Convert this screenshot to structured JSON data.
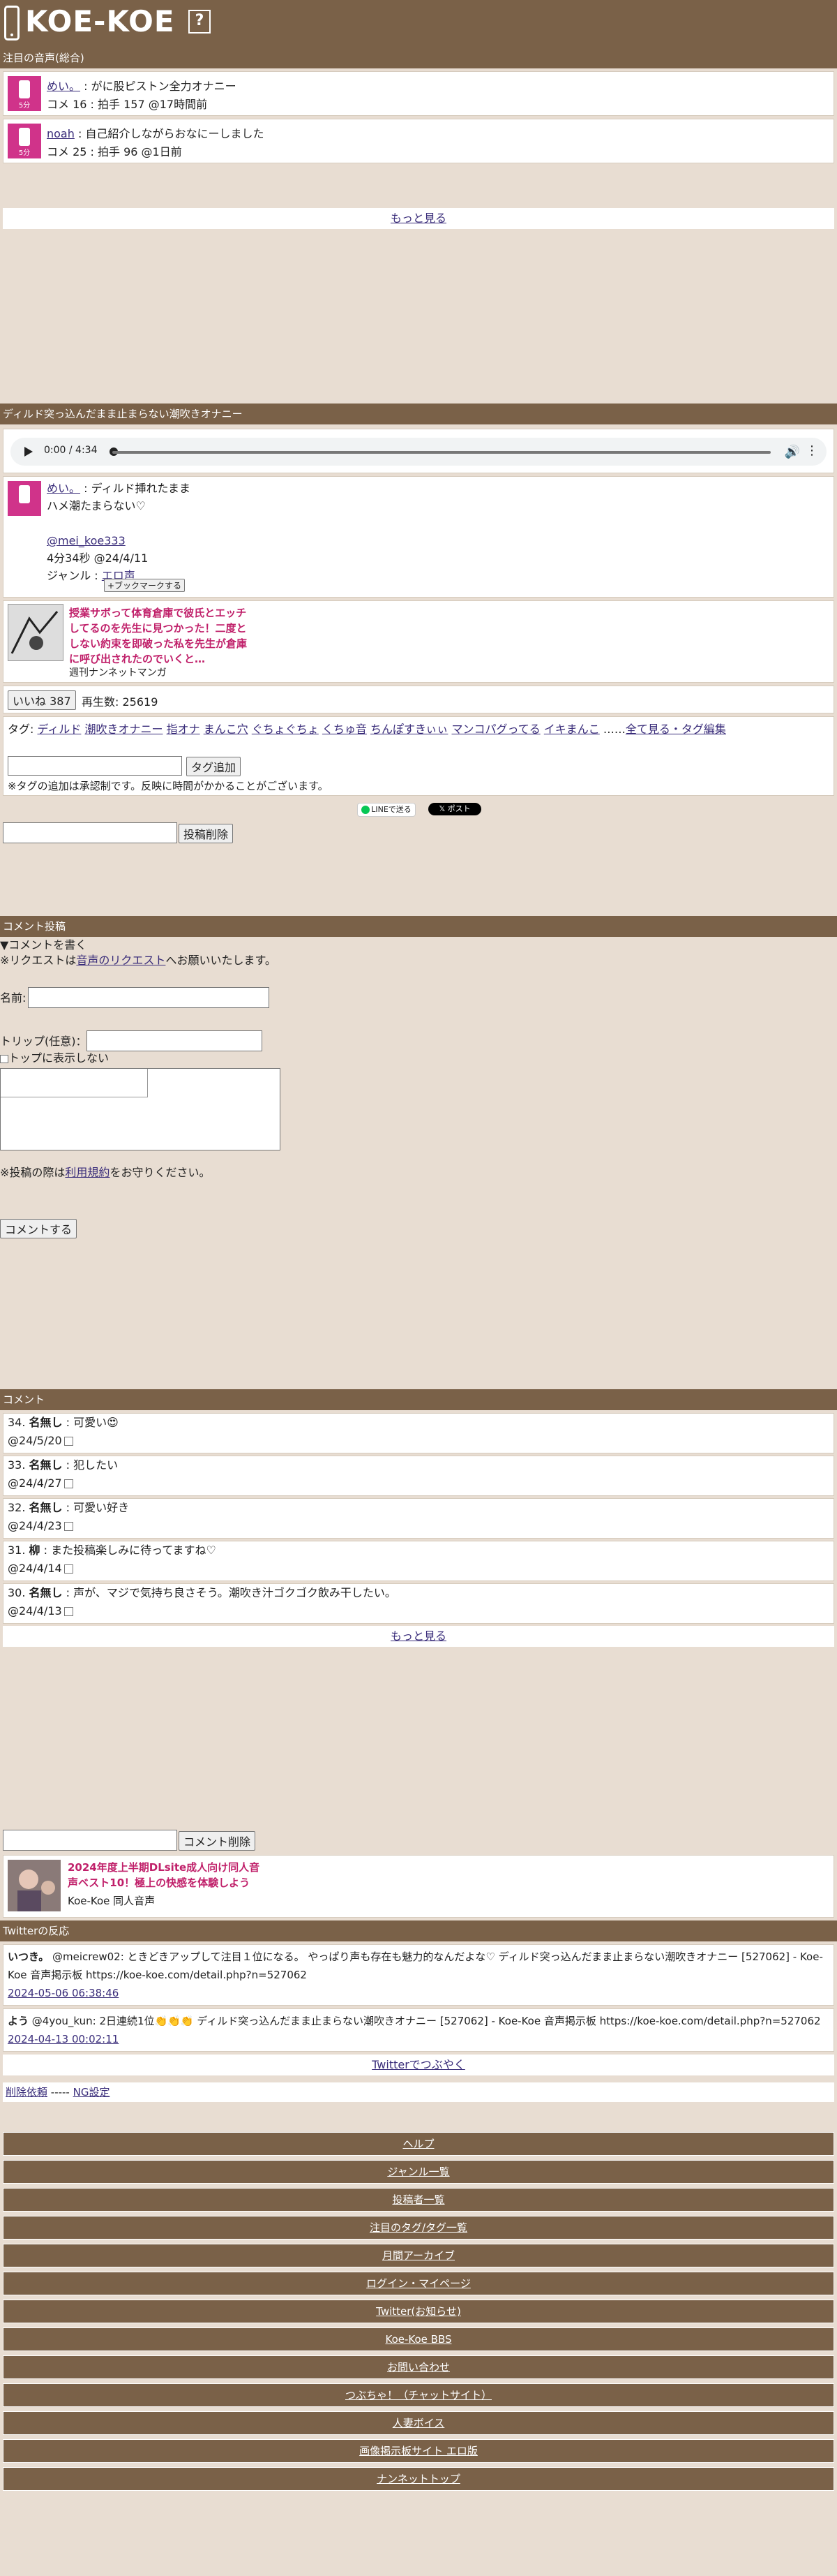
{
  "header": {
    "logo": "KOE-KOE",
    "help": "?"
  },
  "featured": {
    "title": "注目の音声(総合)",
    "items": [
      {
        "user": "めい。",
        "post_title": "がに股ピストン全力オナニー",
        "meta": "コメ 16 : 拍手 157 @17時間前",
        "thumb_label": "5分"
      },
      {
        "user": "noah",
        "post_title": "自己紹介しながらおなにーしました",
        "meta": "コメ 25 : 拍手 96 @1日前",
        "thumb_label": "5分"
      }
    ],
    "more": "もっと見る"
  },
  "post": {
    "title": "ディルド突っ込んだまま止まらない潮吹きオナニー",
    "audio_time": "0:00 / 4:34",
    "user": "めい。",
    "desc1": "ディルド挿れたまま",
    "desc2": "ハメ潮たまらない♡",
    "handle": "@mei_koe333",
    "length": "4分34秒 @24/4/11",
    "genre_label": "ジャンル :",
    "genre": "エロ声",
    "bookmark": "+ブックマークする",
    "ad_title": "授業サボって体育倉庫で彼氏とエッチしてるのを先生に見つかった！二度としない約束を即破った私を先生が倉庫に呼び出されたのでいくと…",
    "ad_source": "週刊ナンネットマンガ",
    "like_btn": "いいね 387",
    "plays": "再生数: 25619",
    "tags_label": "タグ:",
    "tags": [
      "ディルド",
      "潮吹きオナニー",
      "指オナ",
      "まんこ穴",
      "ぐちょぐちょ",
      "くちゅ音",
      "ちんぽすきぃぃ",
      "マンコパグってる",
      "イキまんこ"
    ],
    "tags_sep": "……",
    "tags_all": "全て見る・タグ編集",
    "tag_add": "タグ追加",
    "tag_note": "※タグの追加は承認制です。反映に時間がかかることがございます。",
    "line_btn": "LINEで送る",
    "x_btn": "ポスト",
    "delete_btn": "投稿削除"
  },
  "comment_form": {
    "title": "コメント投稿",
    "toggle": "▼コメントを書く",
    "request_pre": "※リクエストは",
    "request_link": "音声のリクエスト",
    "request_post": "へお願いいたします。",
    "name_label": "名前:",
    "trip_label": "トリップ(任意)：",
    "top_label": "トップに表示しない",
    "rules_pre": "※投稿の際は",
    "rules_link": "利用規約",
    "rules_post": "をお守りください。",
    "submit": "コメントする"
  },
  "comments": {
    "title": "コメント",
    "items": [
      {
        "num": "34.",
        "name": "名無し",
        "text": ": 可愛い😍",
        "date": "@24/5/20"
      },
      {
        "num": "33.",
        "name": "名無し",
        "text": ": 犯したい",
        "date": "@24/4/27"
      },
      {
        "num": "32.",
        "name": "名無し",
        "text": ": 可愛い好き",
        "date": "@24/4/23"
      },
      {
        "num": "31.",
        "name": "柳",
        "text": ": また投稿楽しみに待ってますね♡",
        "date": "@24/4/14"
      },
      {
        "num": "30.",
        "name": "名無し",
        "text": ": 声が、マジで気持ち良さそう。潮吹き汁ゴクゴク飲み干したい。",
        "date": "@24/4/13"
      }
    ],
    "more": "もっと見る",
    "delete_btn": "コメント削除"
  },
  "promo": {
    "title1": "2024年度上半期DLsite成人向け同人音",
    "title2": "声ベスト10！極上の快感を体験しよう",
    "source": "Koe-Koe 同人音声"
  },
  "twitter": {
    "title": "Twitterの反応",
    "items": [
      {
        "user": "いつき。",
        "text": "@meicrew02: ときどきアップして注目１位になる。 やっぱり声も存在も魅力的なんだよな♡ ディルド突っ込んだまま止まらない潮吹きオナニー [527062] - Koe-Koe 音声掲示板 https://koe-koe.com/detail.php?n=527062",
        "date": "2024-05-06 06:38:46"
      },
      {
        "user": "よう",
        "text": "@4you_kun: 2日連続1位👏👏👏 ディルド突っ込んだまま止まらない潮吹きオナニー [527062] - Koe-Koe 音声掲示板 https://koe-koe.com/detail.php?n=527062",
        "date": "2024-04-13 00:02:11"
      }
    ],
    "tweet_link": "Twitterでつぶやく"
  },
  "misc": {
    "delete_req": "削除依頼",
    "sep": " ----- ",
    "ng": "NG設定"
  },
  "footer": [
    "ヘルプ",
    "ジャンル一覧",
    "投稿者一覧",
    "注目のタグ/タグ一覧",
    "月間アーカイブ",
    "ログイン・マイページ",
    "Twitter(お知らせ)",
    "Koe-Koe BBS",
    "お問い合わせ",
    "つぶちゃ！（チャットサイト）",
    "人妻ボイス",
    "画像掲示板サイト エロ版",
    "ナンネットトップ"
  ]
}
